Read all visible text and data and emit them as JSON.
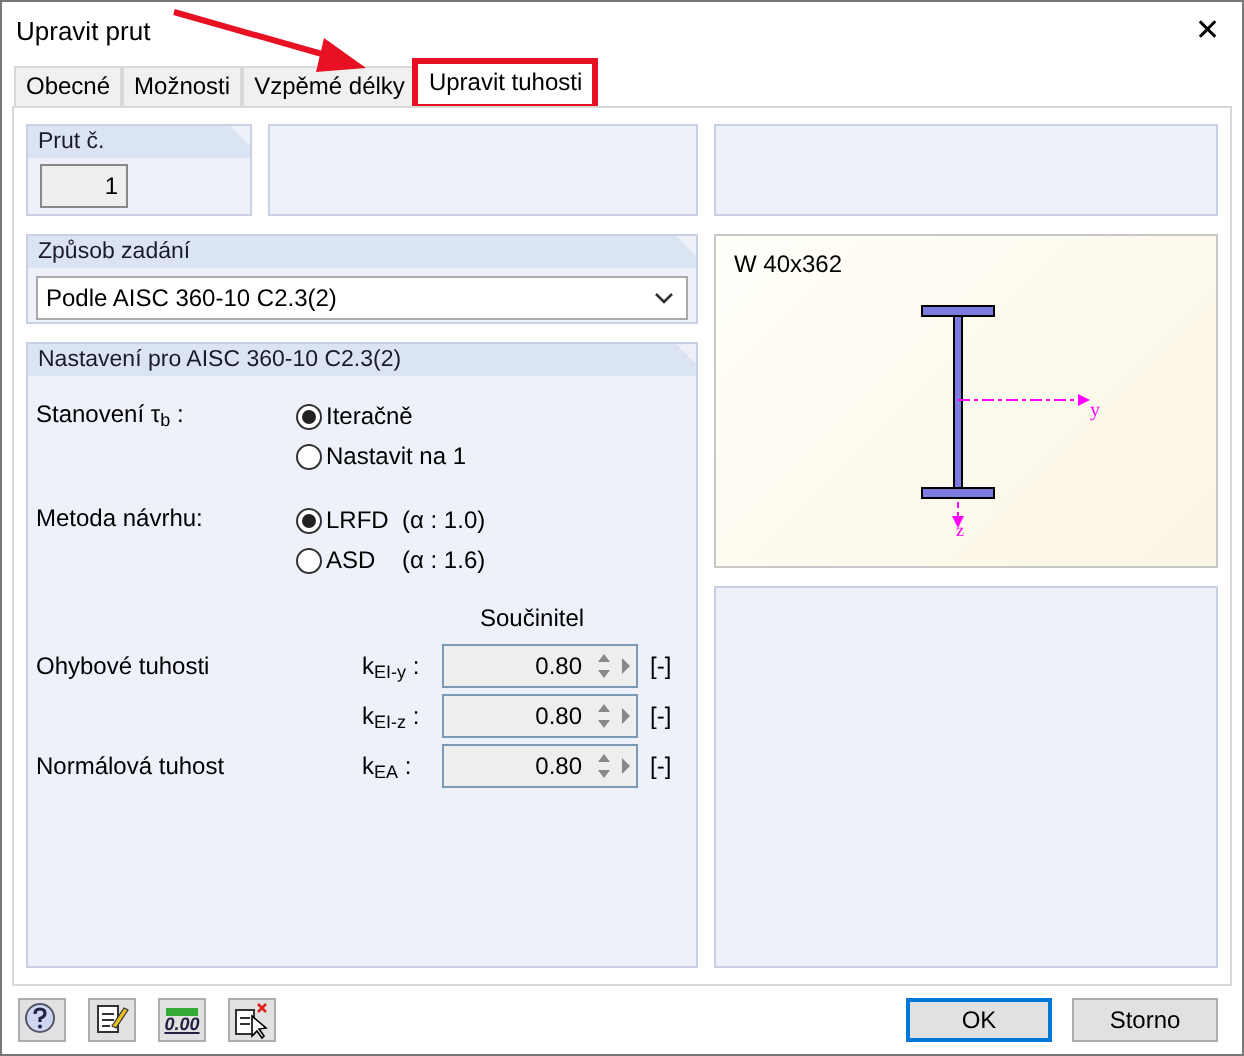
{
  "window": {
    "title": "Upravit prut",
    "close": "✕"
  },
  "tabs": [
    {
      "label": "Obecné",
      "selected": false,
      "highlighted": false
    },
    {
      "label": "Možnosti",
      "selected": false,
      "highlighted": false
    },
    {
      "label": "Vzpěmé délky",
      "selected": false,
      "highlighted": false
    },
    {
      "label": "Upravit tuhosti",
      "selected": true,
      "highlighted": true
    }
  ],
  "annotation_arrow": true,
  "member": {
    "label": "Prut č.",
    "value": "1"
  },
  "input_method": {
    "label": "Způsob zadání",
    "value": "Podle AISC 360-10 C2.3(2)"
  },
  "settings": {
    "title": "Nastavení pro AISC 360-10 C2.3(2)",
    "radio_groups": [
      {
        "label": "Stanovení τ$_{b}$ :",
        "options": [
          {
            "label": "Iteračně",
            "selected": true
          },
          {
            "label": "Nastavit na 1",
            "selected": false
          }
        ]
      },
      {
        "label": "Metoda návrhu:",
        "options": [
          {
            "label": "LRFD",
            "note": "(α : 1.0)",
            "selected": true
          },
          {
            "label": "ASD",
            "note": "(α : 1.6)",
            "selected": false
          }
        ]
      }
    ],
    "factor_header": "Součinitel",
    "factors": [
      {
        "label": "Ohybové tuhosti",
        "symbol": "k$_{EI-y}$ :",
        "value": "0.80",
        "unit": "[-]"
      },
      {
        "symbol": "k$_{EI-z}$ :",
        "value": "0.80",
        "unit": "[-]"
      },
      {
        "label": "Normálová tuhost",
        "symbol": "k$_{EA}$ :",
        "value": "0.80",
        "unit": "[-]"
      }
    ]
  },
  "section": {
    "name": "W 40x362",
    "axis_y": "y",
    "axis_z": "z"
  },
  "toolbar": [
    {
      "kind": "help"
    },
    {
      "kind": "edit"
    },
    {
      "kind": "decimals",
      "label": "0.00"
    },
    {
      "kind": "pick"
    }
  ],
  "buttons": [
    {
      "label": "OK",
      "default": true
    },
    {
      "label": "Storno",
      "default": false
    }
  ]
}
